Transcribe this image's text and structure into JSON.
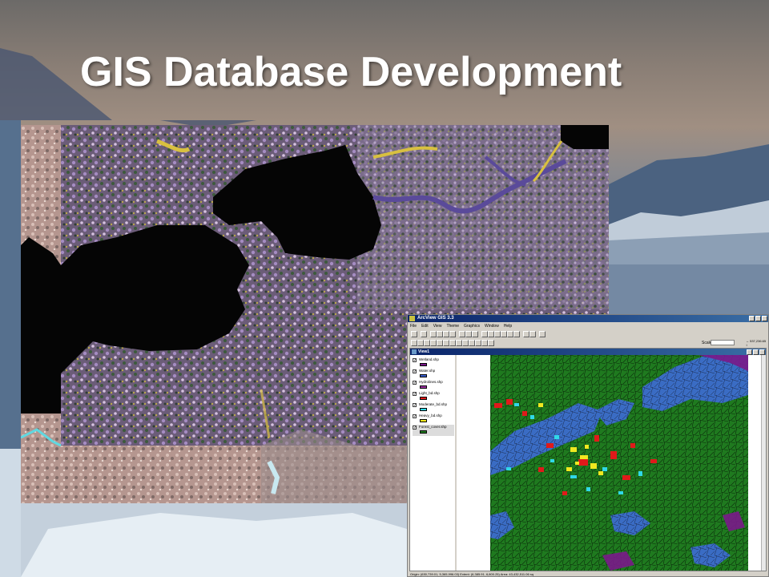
{
  "slide": {
    "title": "GIS Database Development"
  },
  "arcview": {
    "title": "ArcView GIS 3.3",
    "menu": [
      "File",
      "Edit",
      "View",
      "Theme",
      "Graphics",
      "Window",
      "Help"
    ],
    "scale_label": "Scale 1:",
    "coords": [
      "↔ 537,236.65",
      "↕ 5,373,479.03"
    ],
    "view_title": "View1",
    "themes": [
      {
        "name": "Wetland.shp",
        "color": "#7a1a8a",
        "checked": true
      },
      {
        "name": "Water.shp",
        "color": "#3a5fcc",
        "checked": true
      },
      {
        "name": "Hydrolines.shp",
        "color": "#9a30a0",
        "checked": true
      },
      {
        "name": "Light_bd.shp",
        "color": "#e01a1a",
        "checked": true
      },
      {
        "name": "Moderate_bd.shp",
        "color": "#30d8e8",
        "checked": true
      },
      {
        "name": "Heavy_bd.shp",
        "color": "#f0e820",
        "checked": true
      },
      {
        "name": "Forest_cover.shp",
        "color": "#1f7a1f",
        "checked": true
      }
    ],
    "status": "Origin: (630,739.01, 5,365,996.03)    Extent: (6,385.91, 6,800.25)    Area: 43,432,511.06 sq"
  },
  "colors": {
    "forest": "#1f7a1f",
    "water": "#3a6cc4",
    "wetland": "#7a1a8a",
    "light": "#e01a1a",
    "moderate": "#30d8e8",
    "heavy": "#f0e820"
  }
}
